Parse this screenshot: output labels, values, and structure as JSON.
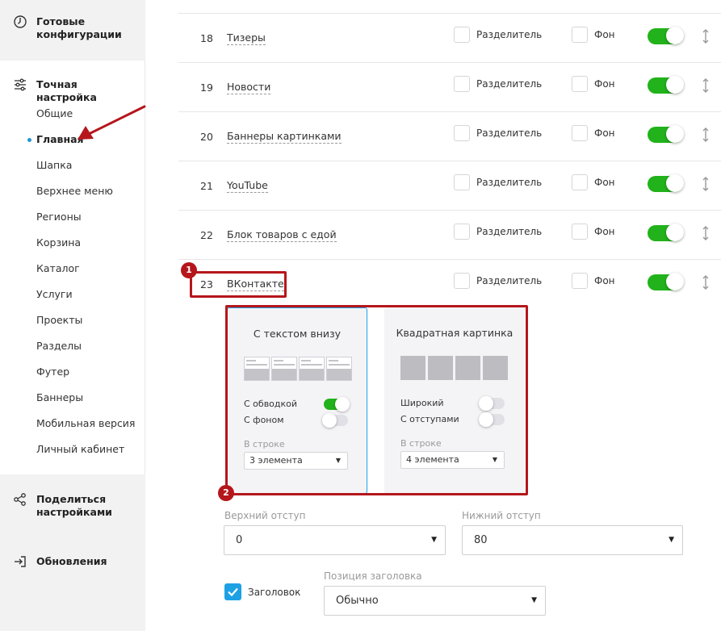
{
  "sidebar": {
    "ready_configs": "Готовые конфигурации",
    "fine_tuning": "Точная настройка",
    "items": [
      {
        "label": "Общие",
        "active": false
      },
      {
        "label": "Главная",
        "active": true
      },
      {
        "label": "Шапка",
        "active": false
      },
      {
        "label": "Верхнее меню",
        "active": false
      },
      {
        "label": "Регионы",
        "active": false
      },
      {
        "label": "Корзина",
        "active": false
      },
      {
        "label": "Каталог",
        "active": false
      },
      {
        "label": "Услуги",
        "active": false
      },
      {
        "label": "Проекты",
        "active": false
      },
      {
        "label": "Разделы",
        "active": false
      },
      {
        "label": "Футер",
        "active": false
      },
      {
        "label": "Баннеры",
        "active": false
      },
      {
        "label": "Мобильная версия",
        "active": false
      },
      {
        "label": "Личный кабинет",
        "active": false
      }
    ],
    "share": "Поделиться настройками",
    "updates": "Обновления"
  },
  "rows": [
    {
      "num": "18",
      "title": "Тизеры"
    },
    {
      "num": "19",
      "title": "Новости"
    },
    {
      "num": "20",
      "title": "Баннеры картинками"
    },
    {
      "num": "21",
      "title": "YouTube"
    },
    {
      "num": "22",
      "title": "Блок товаров с едой"
    },
    {
      "num": "23",
      "title": "ВКонтакте"
    }
  ],
  "row_labels": {
    "divider": "Разделитель",
    "background": "Фон"
  },
  "badges": {
    "one": "1",
    "two": "2"
  },
  "cards": {
    "text_bottom": {
      "title": "С текстом внизу",
      "opt1": "С обводкой",
      "opt2": "С фоном",
      "per_row_label": "В строке",
      "per_row_value": "3 элемента"
    },
    "square": {
      "title": "Квадратная картинка",
      "opt1": "Широкий",
      "opt2": "С отступами",
      "per_row_label": "В строке",
      "per_row_value": "4 элемента"
    }
  },
  "fields": {
    "top_padding_label": "Верхний отступ",
    "top_padding_value": "0",
    "bottom_padding_label": "Нижний отступ",
    "bottom_padding_value": "80",
    "heading_checkbox": "Заголовок",
    "heading_pos_label": "Позиция заголовка",
    "heading_pos_value": "Обычно"
  },
  "colors": {
    "accent_green": "#22b21b",
    "annotation_red": "#b5161b",
    "active_dot": "#2196d3",
    "checkbox_blue": "#1da1e4"
  }
}
